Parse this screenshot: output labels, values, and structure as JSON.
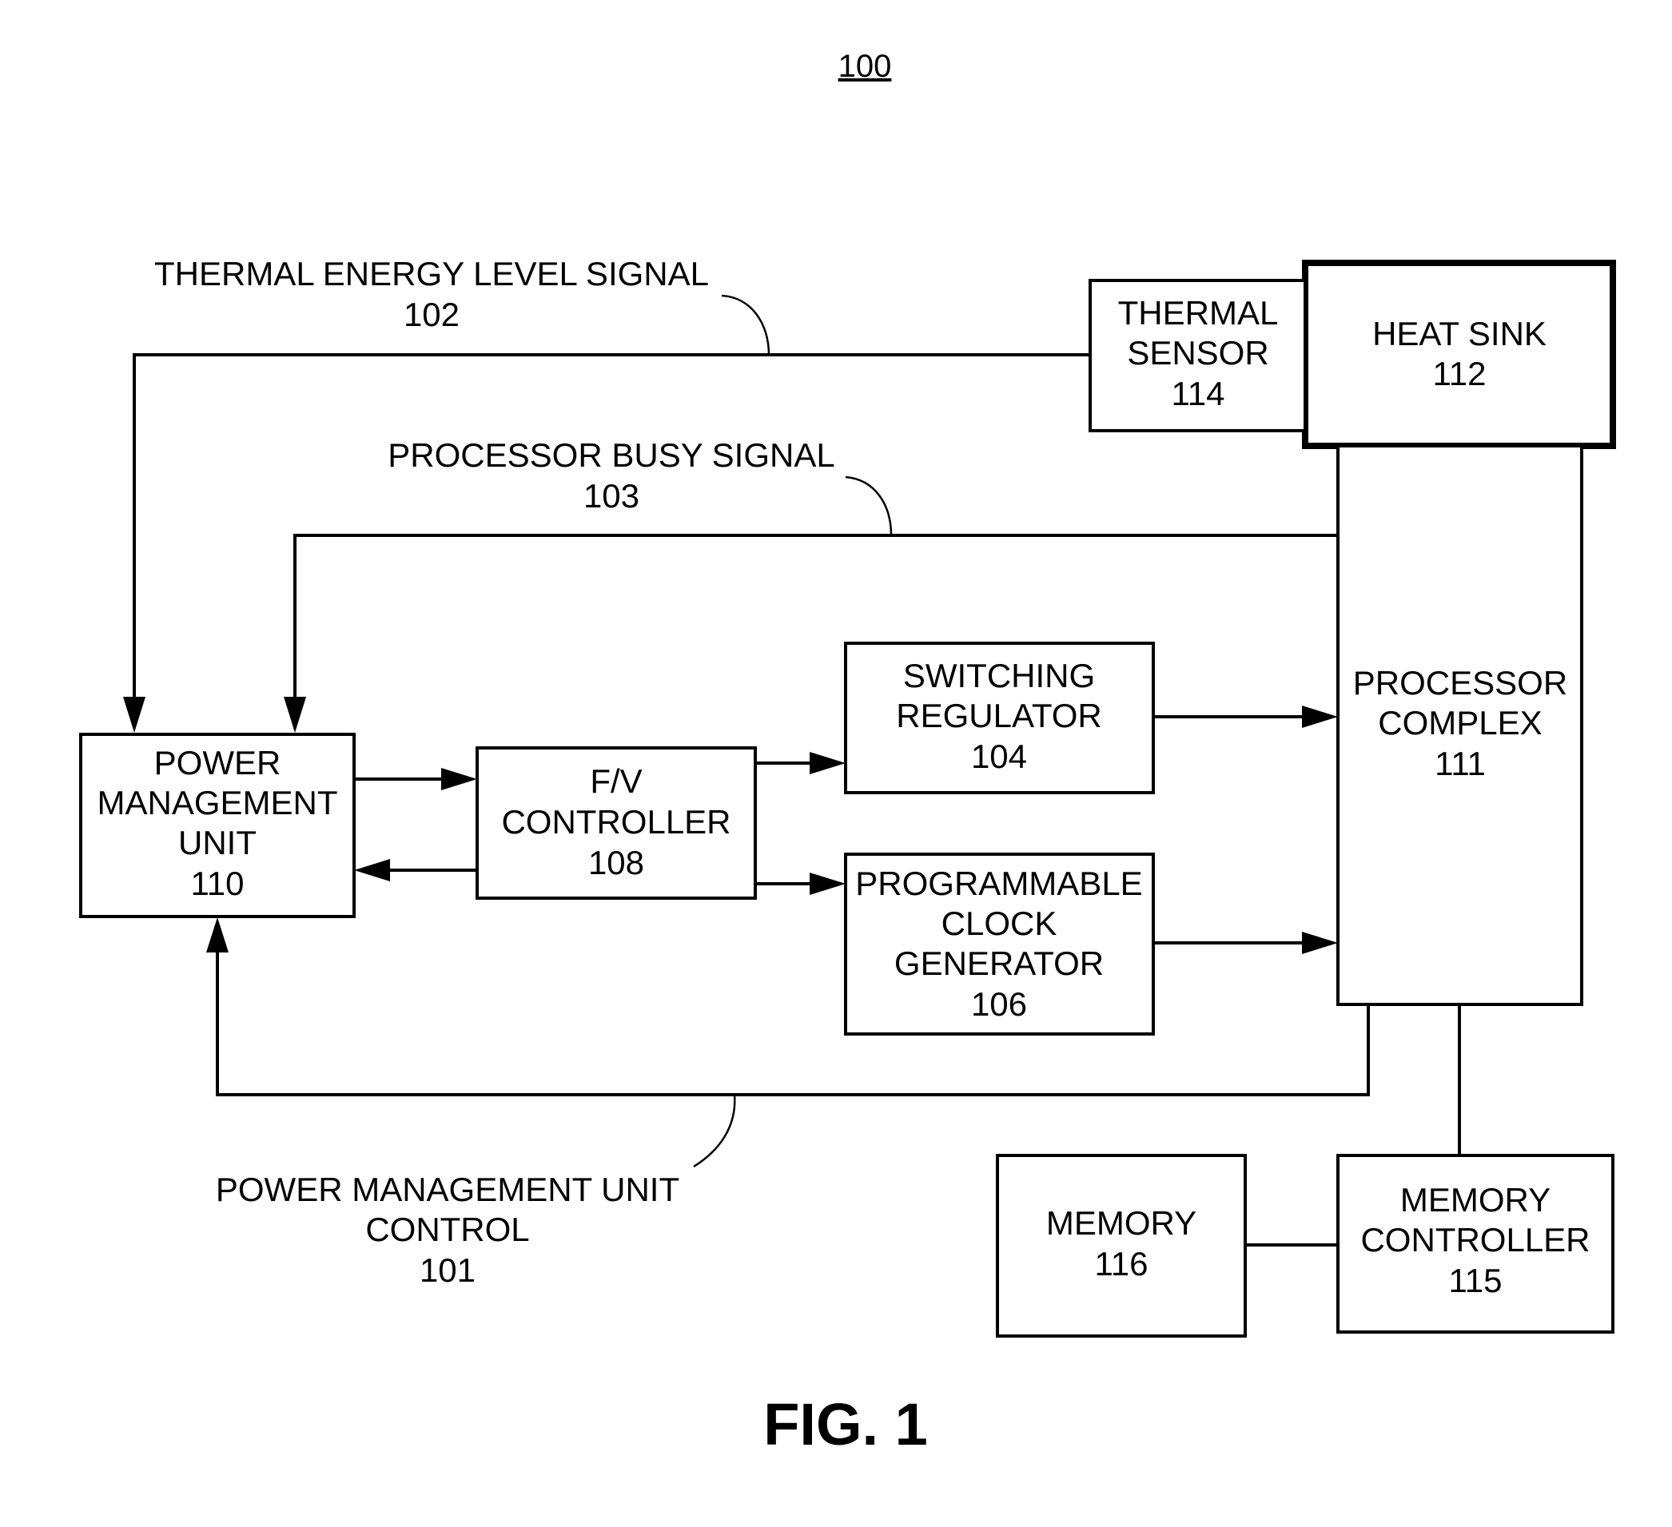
{
  "figure": {
    "reference_number": "100",
    "caption": "FIG. 1"
  },
  "blocks": {
    "thermal_sensor": {
      "lines": [
        "THERMAL",
        "SENSOR",
        "114"
      ]
    },
    "heat_sink": {
      "lines": [
        "HEAT SINK",
        "112"
      ]
    },
    "processor_complex": {
      "lines": [
        "PROCESSOR",
        "COMPLEX",
        "111"
      ]
    },
    "switching_regulator": {
      "lines": [
        "SWITCHING",
        "REGULATOR",
        "104"
      ]
    },
    "programmable_clock_generator": {
      "lines": [
        "PROGRAMMABLE",
        "CLOCK",
        "GENERATOR",
        "106"
      ]
    },
    "fv_controller": {
      "lines": [
        "F/V",
        "CONTROLLER",
        "108"
      ]
    },
    "power_management_unit": {
      "lines": [
        "POWER",
        "MANAGEMENT",
        "UNIT",
        "110"
      ]
    },
    "memory": {
      "lines": [
        "MEMORY",
        "116"
      ]
    },
    "memory_controller": {
      "lines": [
        "MEMORY",
        "CONTROLLER",
        "115"
      ]
    }
  },
  "signals": {
    "thermal_energy_level": {
      "lines": [
        "THERMAL ENERGY LEVEL SIGNAL",
        "102"
      ]
    },
    "processor_busy": {
      "lines": [
        "PROCESSOR BUSY SIGNAL",
        "103"
      ]
    },
    "pmu_control": {
      "lines": [
        "POWER MANAGEMENT UNIT",
        "CONTROL",
        "101"
      ]
    }
  },
  "connections": [
    {
      "from": "thermal_sensor",
      "to": "power_management_unit",
      "label": "thermal_energy_level"
    },
    {
      "from": "processor_complex",
      "to": "power_management_unit",
      "label": "processor_busy"
    },
    {
      "from": "processor_complex",
      "to": "power_management_unit",
      "label": "pmu_control"
    },
    {
      "from": "power_management_unit",
      "to": "fv_controller"
    },
    {
      "from": "fv_controller",
      "to": "power_management_unit"
    },
    {
      "from": "fv_controller",
      "to": "switching_regulator"
    },
    {
      "from": "fv_controller",
      "to": "programmable_clock_generator"
    },
    {
      "from": "switching_regulator",
      "to": "processor_complex"
    },
    {
      "from": "programmable_clock_generator",
      "to": "processor_complex"
    },
    {
      "from": "processor_complex",
      "to": "memory_controller"
    },
    {
      "from": "memory_controller",
      "to": "memory"
    }
  ]
}
